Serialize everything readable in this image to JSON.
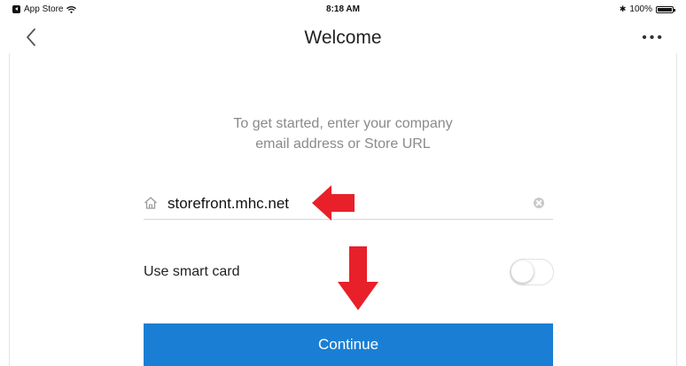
{
  "status_bar": {
    "back_app": "App Store",
    "time": "8:18 AM",
    "battery": "100%"
  },
  "nav": {
    "title": "Welcome",
    "more": "•••",
    "back_icon": "chevron-left-icon"
  },
  "intro": {
    "line1": "To get started, enter your company",
    "line2": "email address or Store URL"
  },
  "url_field": {
    "value": "storefront.mhc.net",
    "icon": "home-icon"
  },
  "smart_card": {
    "label": "Use smart card",
    "enabled": false
  },
  "continue_label": "Continue",
  "colors": {
    "accent": "#1a7fd4",
    "annotation_arrow": "#e8202a"
  }
}
